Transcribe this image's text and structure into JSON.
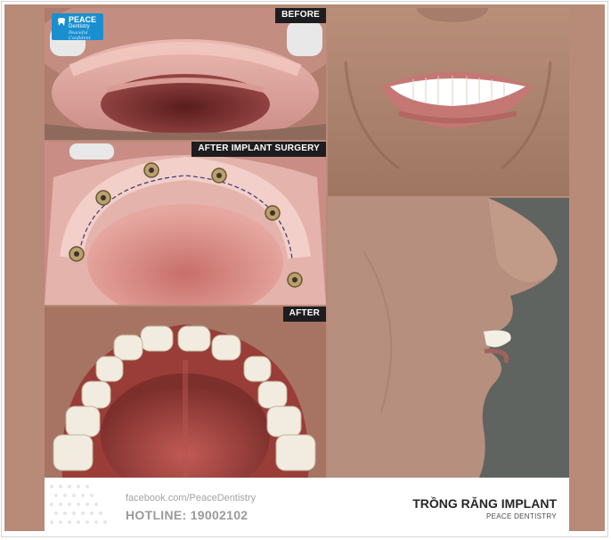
{
  "panels": {
    "before_label": "BEFORE",
    "surgery_label": "AFTER IMPLANT SURGERY",
    "after_label": "AFTER"
  },
  "logo": {
    "line1": "PEACE",
    "line2": "Dentistry",
    "line3": "Peaceful Confident"
  },
  "footer": {
    "facebook": "facebook.com/PeaceDentistry",
    "hotline": "HOTLINE: 19002102",
    "title": "TRỒNG RĂNG IMPLANT",
    "subtitle": "PEACE DENTISTRY"
  },
  "colors": {
    "border": "#b88a78",
    "label_bg": "#1d1d1f",
    "logo_bg": "#1a8fd0"
  }
}
